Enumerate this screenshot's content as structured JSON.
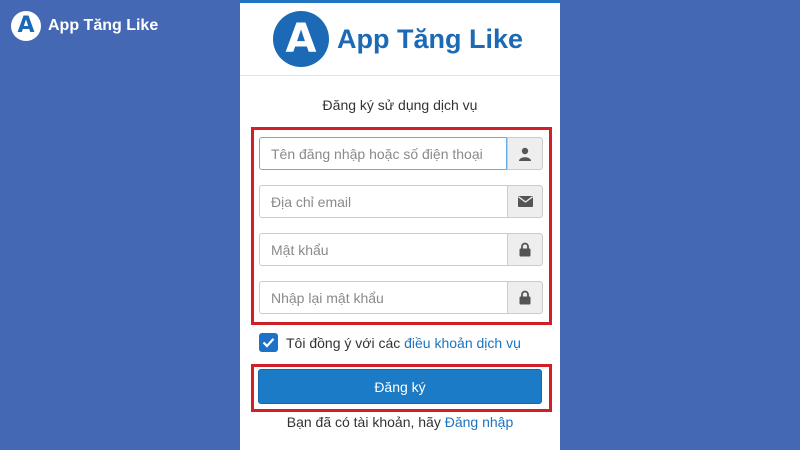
{
  "watermark": {
    "logo_letter": "A",
    "text": "App Tăng Like"
  },
  "header": {
    "logo_letter": "A",
    "brand": "App Tăng Like"
  },
  "form": {
    "title": "Đăng ký sử dụng dịch vụ",
    "fields": [
      {
        "placeholder": "Tên đăng nhập hoặc số điện thoại",
        "value": "",
        "icon": "user-icon"
      },
      {
        "placeholder": "Địa chỉ email",
        "value": "",
        "icon": "envelope-icon"
      },
      {
        "placeholder": "Mật khẩu",
        "value": "",
        "icon": "lock-icon"
      },
      {
        "placeholder": "Nhập lại mật khẩu",
        "value": "",
        "icon": "lock-icon"
      }
    ],
    "agree": {
      "checked": true,
      "text": "Tôi đồng ý với các",
      "link": "điều khoản dịch vụ"
    },
    "submit_label": "Đăng ký",
    "footer": {
      "text": "Bạn đã có tài khoản, hãy",
      "link": "Đăng nhập"
    }
  },
  "colors": {
    "background": "#4568b4",
    "brand": "#1c6ab5",
    "button": "#1b7bc6",
    "highlight": "#d01f26",
    "link": "#1c73c0"
  }
}
